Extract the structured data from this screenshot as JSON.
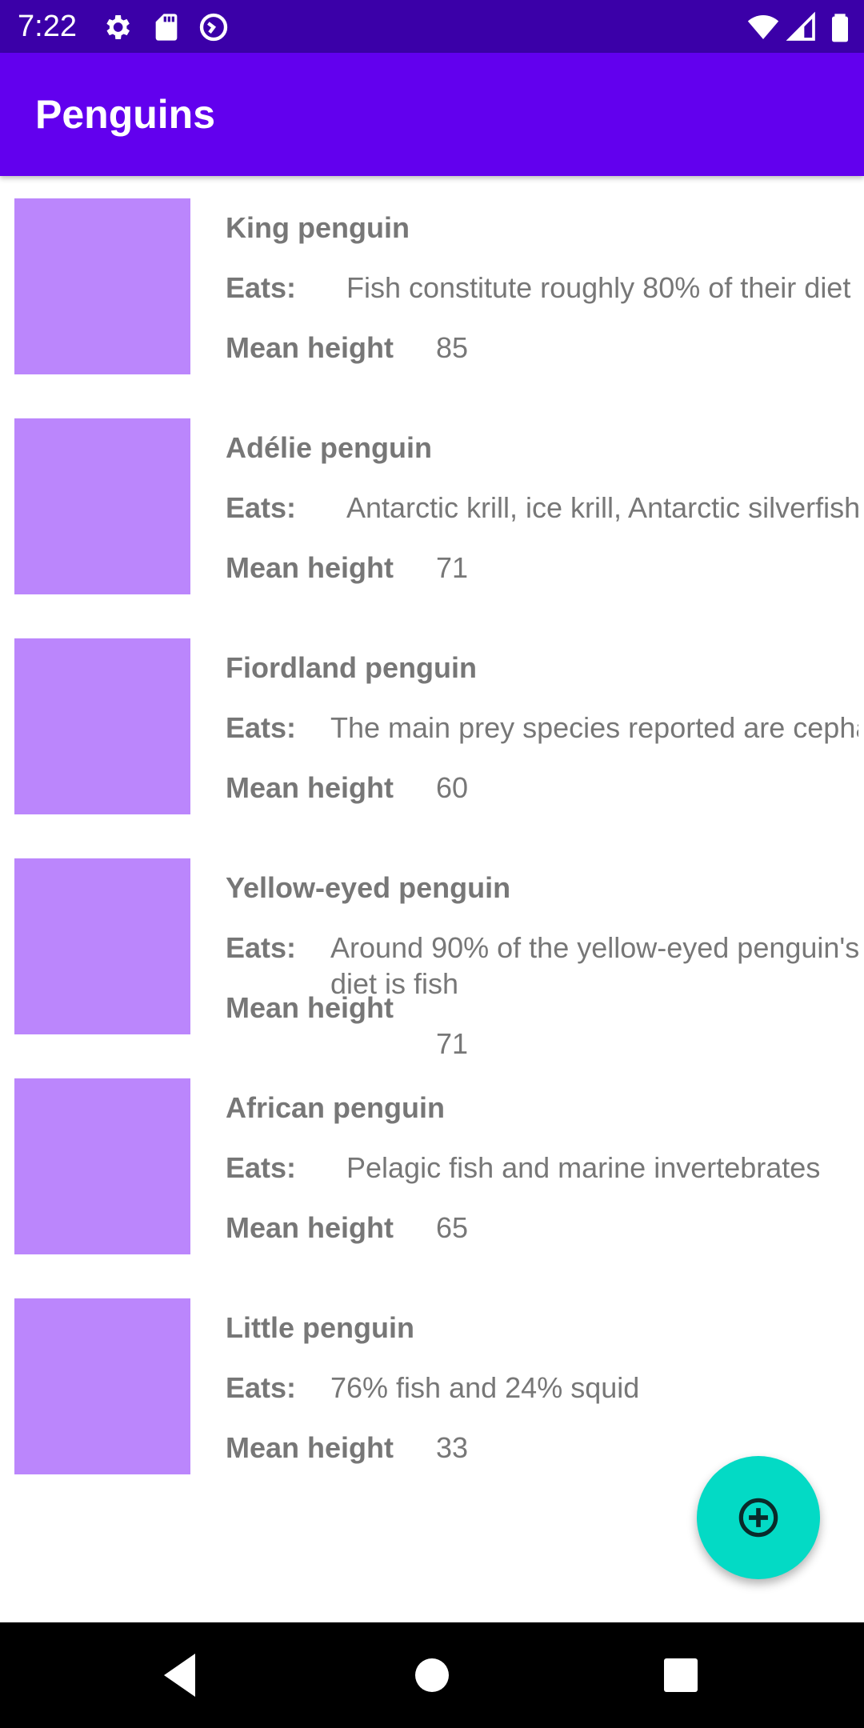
{
  "status_bar": {
    "time": "7:22",
    "icons": [
      "settings-icon",
      "sd-card-icon",
      "vpn-icon",
      "wifi-icon",
      "signal-icon",
      "battery-icon"
    ]
  },
  "app_bar": {
    "title": "Penguins"
  },
  "labels": {
    "eats": "Eats:",
    "mean_height": "Mean height"
  },
  "penguins": [
    {
      "name": "King penguin",
      "eats": "Fish constitute roughly 80% of their diet",
      "mean_height": "85"
    },
    {
      "name": "Adélie penguin",
      "eats": "Antarctic krill, ice krill, Antarctic silverfish",
      "mean_height": "71"
    },
    {
      "name": "Fiordland penguin",
      "eats": "The main prey species reported are cephalopods",
      "mean_height": "60"
    },
    {
      "name": "Yellow-eyed penguin",
      "eats": "Around 90% of the yellow-eyed penguin's diet is fish",
      "mean_height": "71"
    },
    {
      "name": "African penguin",
      "eats": "Pelagic fish and marine invertebrates",
      "mean_height": "65"
    },
    {
      "name": "Little penguin",
      "eats": "76% fish and 24% squid",
      "mean_height": "33"
    }
  ],
  "colors": {
    "status_bar": "#3b00a8",
    "app_bar": "#6200ee",
    "thumbnail": "#bb86fc",
    "fab": "#03dac5",
    "text": "#777777"
  },
  "fab": {
    "icon": "add-circle-icon"
  },
  "nav_bar": {
    "icons": [
      "back-icon",
      "home-icon",
      "recents-icon"
    ]
  }
}
